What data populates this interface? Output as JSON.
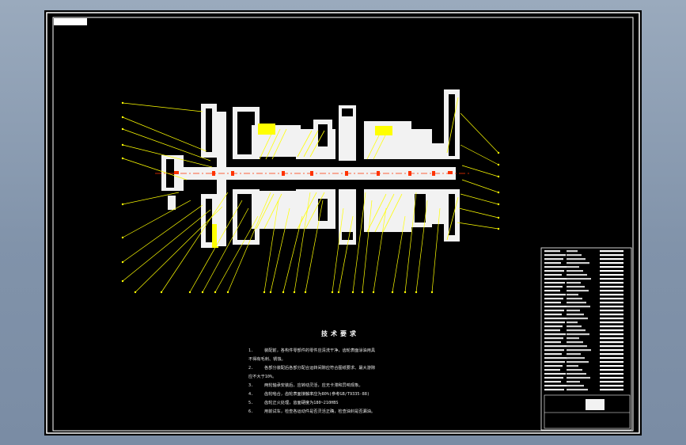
{
  "colors": {
    "frame": "#ffffff",
    "background": "#000000",
    "part_fill": "#f2f2f2",
    "leader": "#ffff00",
    "highlight": "#ff3300",
    "hatch": "#ffff00"
  },
  "technical_requirements": {
    "title": "技术要求",
    "items": [
      {
        "num": "1.",
        "text": "装配前，各构件零部件的零件应清洗干净，齿轮表面涂油用具",
        "cont": "不得有毛刺、锈蚀。"
      },
      {
        "num": "2.",
        "text": "各部分装配后各部分配合运转间隙应符合图纸要求、最大游隙",
        "cont": "应不大于10%。"
      },
      {
        "num": "3.",
        "text": "两轮轴承安装后，应转动灵活，应无卡滞和异响现象。",
        "cont": ""
      },
      {
        "num": "4.",
        "text": "齿轮啮合，齿轮表面接触率应为80%(参考GB/T9335-88)",
        "cont": ""
      },
      {
        "num": "5.",
        "text": "齿轮正火处理，齿面硬度为180~210HBS",
        "cont": ""
      },
      {
        "num": "6.",
        "text": "用前试车，检查各运动件是否灵活正确，检查油封是否漏油。",
        "cont": ""
      }
    ]
  }
}
